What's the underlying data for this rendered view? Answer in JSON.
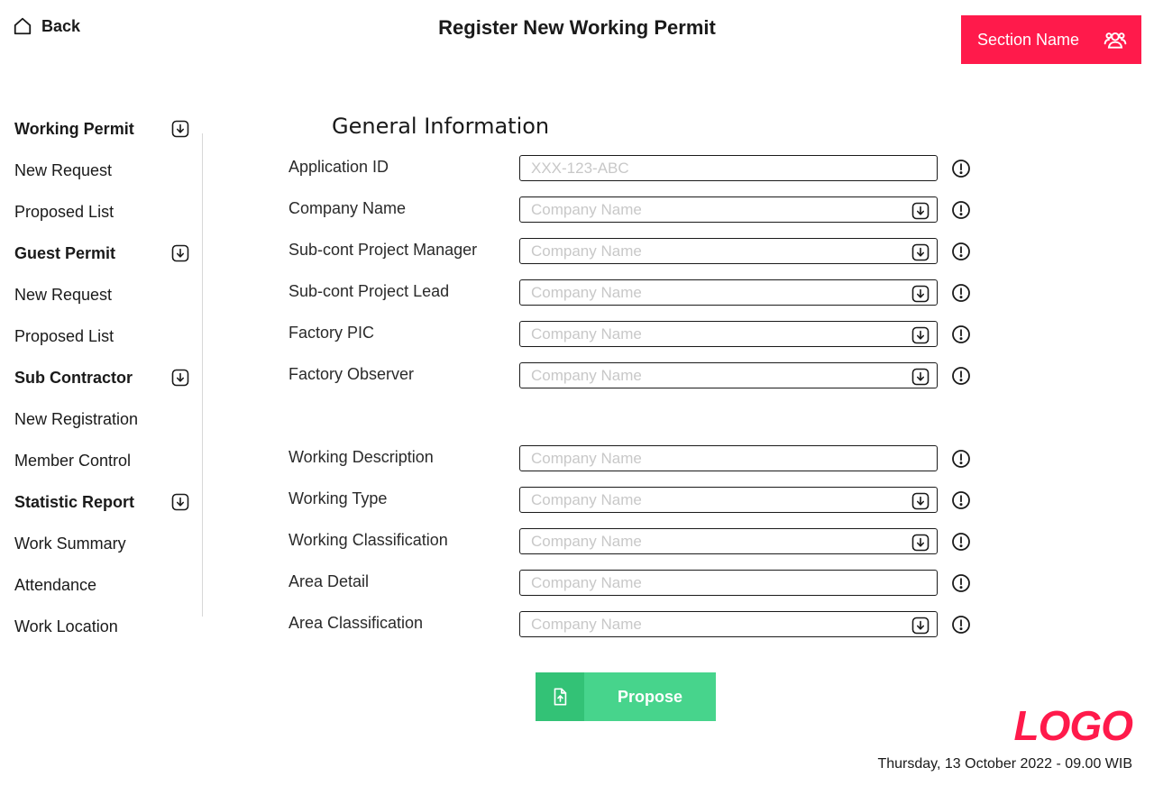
{
  "header": {
    "back_label": "Back",
    "title": "Register New Working Permit",
    "section_label": "Section Name",
    "section_icon": "users-icon",
    "accent_color": "#ff1a4b"
  },
  "sidebar": {
    "items": [
      {
        "label": "Working Permit",
        "type": "header"
      },
      {
        "label": "New Request",
        "type": "item"
      },
      {
        "label": "Proposed List",
        "type": "item"
      },
      {
        "label": "Guest Permit",
        "type": "header"
      },
      {
        "label": "New Request",
        "type": "item"
      },
      {
        "label": "Proposed List",
        "type": "item"
      },
      {
        "label": "Sub Contractor",
        "type": "header"
      },
      {
        "label": "New Registration",
        "type": "item"
      },
      {
        "label": "Member Control",
        "type": "item"
      },
      {
        "label": "Statistic Report",
        "type": "header"
      },
      {
        "label": "Work Summary",
        "type": "item"
      },
      {
        "label": "Attendance",
        "type": "item"
      },
      {
        "label": "Work Location",
        "type": "item"
      }
    ]
  },
  "form": {
    "title": "General Information",
    "fields": [
      {
        "label": "Application ID",
        "placeholder": "XXX-123-ABC",
        "kind": "text"
      },
      {
        "label": "Company Name",
        "placeholder": "Company Name",
        "kind": "select"
      },
      {
        "label": "Sub-cont Project Manager",
        "placeholder": "Company Name",
        "kind": "select"
      },
      {
        "label": "Sub-cont Project Lead",
        "placeholder": "Company Name",
        "kind": "select"
      },
      {
        "label": "Factory PIC",
        "placeholder": "Company Name",
        "kind": "select"
      },
      {
        "label": "Factory Observer",
        "placeholder": "Company Name",
        "kind": "select"
      },
      {
        "label": "Working Description",
        "placeholder": "Company Name",
        "kind": "text"
      },
      {
        "label": "Working Type",
        "placeholder": "Company Name",
        "kind": "select"
      },
      {
        "label": "Working Classification",
        "placeholder": "Company Name",
        "kind": "select"
      },
      {
        "label": "Area Detail",
        "placeholder": "Company Name",
        "kind": "text"
      },
      {
        "label": "Area Classification",
        "placeholder": "Company Name",
        "kind": "select"
      }
    ],
    "submit_label": "Propose",
    "submit_icon": "file-upload-icon",
    "submit_color": "#47d48c"
  },
  "footer": {
    "logo": "LOGO",
    "datetime": "Thursday, 13 October 2022 - 09.00 WIB"
  }
}
